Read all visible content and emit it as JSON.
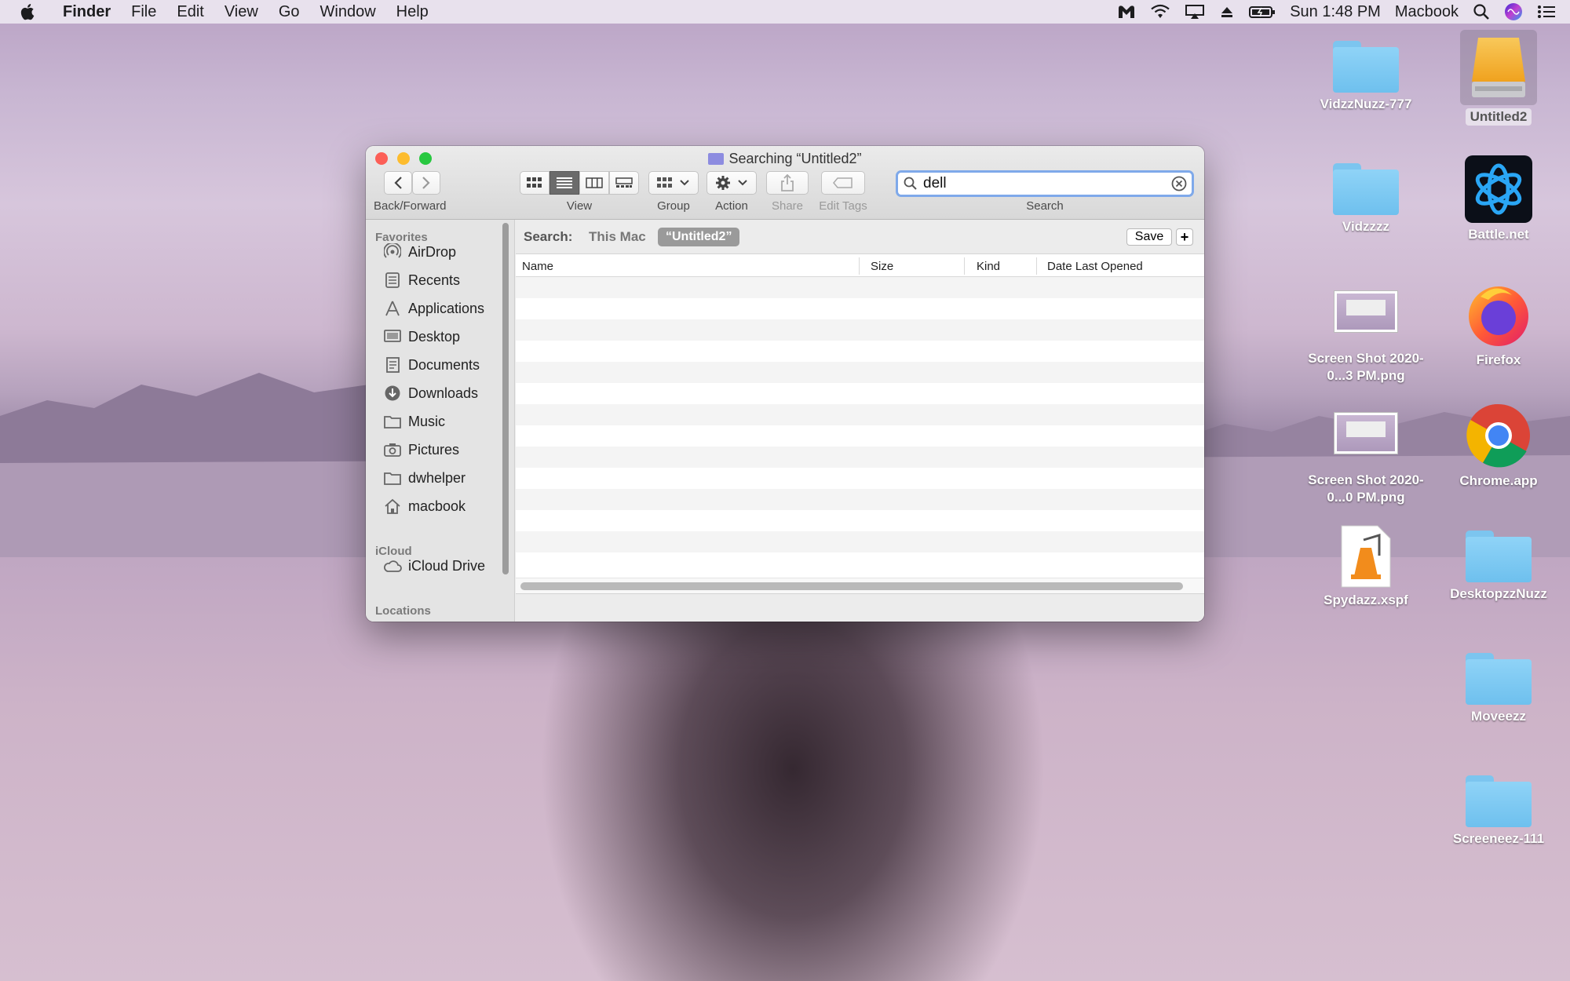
{
  "menubar": {
    "app": "Finder",
    "items": [
      "File",
      "Edit",
      "View",
      "Go",
      "Window",
      "Help"
    ],
    "clock": "Sun 1:48 PM",
    "user": "Macbook"
  },
  "desktop": {
    "icons": [
      {
        "label": "VidzzNuzz-777"
      },
      {
        "label": "Untitled2"
      },
      {
        "label": "Vidzzzz"
      },
      {
        "label": "Battle.net"
      },
      {
        "label": "Screen Shot 2020-0...3 PM.png"
      },
      {
        "label": "Firefox"
      },
      {
        "label": "Screen Shot 2020-0...0 PM.png"
      },
      {
        "label": "Chrome.app"
      },
      {
        "label": "Spydazz.xspf"
      },
      {
        "label": "DesktopzzNuzz"
      },
      {
        "label": "Moveezz"
      },
      {
        "label": "Screeneez-111"
      }
    ]
  },
  "window": {
    "title": "Searching “Untitled2”",
    "toolbar": {
      "back_forward": "Back/Forward",
      "view": "View",
      "group": "Group",
      "action": "Action",
      "share": "Share",
      "edit_tags": "Edit Tags",
      "search": "Search"
    },
    "search": {
      "value": "dell"
    },
    "sidebar": {
      "favorites_header": "Favorites",
      "favorites": [
        "AirDrop",
        "Recents",
        "Applications",
        "Desktop",
        "Documents",
        "Downloads",
        "Music",
        "Pictures",
        "dwhelper",
        "macbook"
      ],
      "icloud_header": "iCloud",
      "icloud": [
        "iCloud Drive"
      ],
      "locations_header": "Locations"
    },
    "scope": {
      "label": "Search:",
      "this_mac": "This Mac",
      "selected": "“Untitled2”",
      "save": "Save",
      "plus": "+"
    },
    "columns": [
      "Name",
      "Size",
      "Kind",
      "Date Last Opened"
    ]
  },
  "colors": {
    "search_focus": "#7fa9ea",
    "close": "#fc5f57",
    "minimize": "#fdbc2e",
    "zoom": "#28c840",
    "folder": "#8fd3f7"
  }
}
